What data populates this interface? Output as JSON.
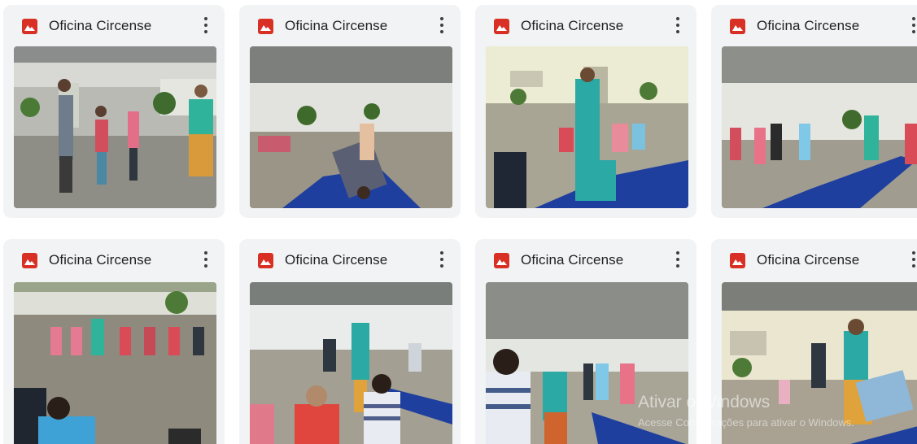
{
  "cards": [
    {
      "title": "Oficina Circense",
      "icon": "image-file-icon",
      "menu_icon": "more-vert-icon"
    },
    {
      "title": "Oficina Circense",
      "icon": "image-file-icon",
      "menu_icon": "more-vert-icon"
    },
    {
      "title": "Oficina Circense",
      "icon": "image-file-icon",
      "menu_icon": "more-vert-icon"
    },
    {
      "title": "Oficina Circense",
      "icon": "image-file-icon",
      "menu_icon": "more-vert-icon"
    },
    {
      "title": "Oficina Circense",
      "icon": "image-file-icon",
      "menu_icon": "more-vert-icon"
    },
    {
      "title": "Oficina Circense",
      "icon": "image-file-icon",
      "menu_icon": "more-vert-icon"
    },
    {
      "title": "Oficina Circense",
      "icon": "image-file-icon",
      "menu_icon": "more-vert-icon"
    },
    {
      "title": "Oficina Circense",
      "icon": "image-file-icon",
      "menu_icon": "more-vert-icon"
    }
  ],
  "watermark": {
    "line1": "Ativar o Windows",
    "line2": "Acesse Configurações para ativar o Windows."
  },
  "colors": {
    "card_bg": "#f1f3f4",
    "file_icon": "#d93025",
    "mat_blue": "#1f3f9e"
  }
}
